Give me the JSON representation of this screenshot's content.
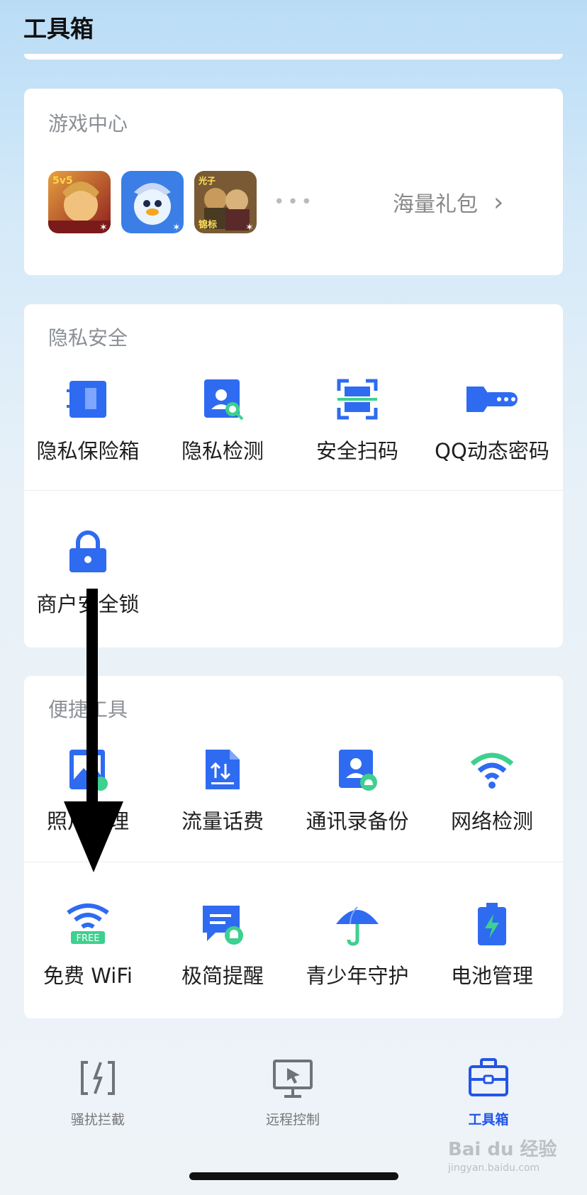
{
  "header": {
    "title": "工具箱"
  },
  "game_center": {
    "title": "游戏中心",
    "games": [
      {
        "name": "game-honor-of-kings",
        "badge": "5v5",
        "colors": [
          "#c0392b",
          "#e9b04a"
        ]
      },
      {
        "name": "game-penguin",
        "badge": "",
        "colors": [
          "#2d6fe0",
          "#7cc7f4"
        ]
      },
      {
        "name": "game-pubg",
        "badge": "光子",
        "colors": [
          "#6a4a2b",
          "#caa25a"
        ]
      }
    ],
    "more": "•••",
    "gift_label": "海量礼包"
  },
  "privacy": {
    "title": "隐私安全",
    "items": [
      {
        "label": "隐私保险箱",
        "icon": "safe-box-icon"
      },
      {
        "label": "隐私检测",
        "icon": "privacy-scan-icon"
      },
      {
        "label": "安全扫码",
        "icon": "qr-scan-icon"
      },
      {
        "label": "QQ动态密码",
        "icon": "key-icon"
      },
      {
        "label": "商户安全锁",
        "icon": "lock-icon"
      }
    ]
  },
  "tools": {
    "title": "便捷工具",
    "items": [
      {
        "label": "照片清理",
        "icon": "photo-clean-icon"
      },
      {
        "label": "流量话费",
        "icon": "data-bill-icon"
      },
      {
        "label": "通讯录备份",
        "icon": "contacts-backup-icon"
      },
      {
        "label": "网络检测",
        "icon": "wifi-check-icon"
      },
      {
        "label": "免费 WiFi",
        "icon": "free-wifi-icon",
        "badge": "FREE"
      },
      {
        "label": "极简提醒",
        "icon": "reminder-icon"
      },
      {
        "label": "青少年守护",
        "icon": "umbrella-icon"
      },
      {
        "label": "电池管理",
        "icon": "battery-icon"
      }
    ]
  },
  "bottom_nav": {
    "items": [
      {
        "label": "骚扰拦截",
        "icon": "block-call-icon",
        "active": false
      },
      {
        "label": "远程控制",
        "icon": "remote-control-icon",
        "active": false
      },
      {
        "label": "工具箱",
        "icon": "toolbox-icon",
        "active": true
      }
    ]
  },
  "watermark": {
    "text": "Bai du 经验",
    "sub": "jingyan.baidu.com"
  },
  "colors": {
    "accent": "#2f6bf0",
    "green": "#3ed08e",
    "nav_active": "#2355e6"
  }
}
